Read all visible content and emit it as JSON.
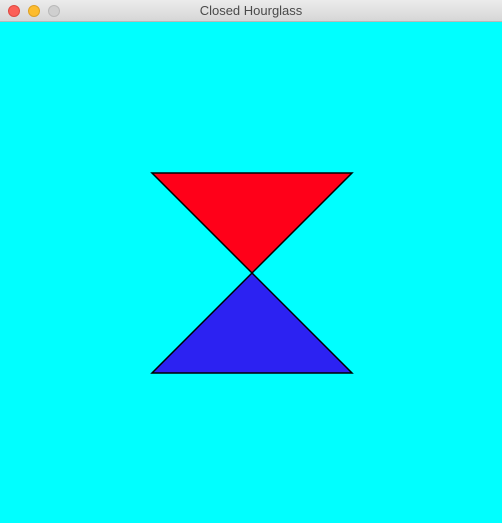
{
  "window": {
    "title": "Closed Hourglass"
  },
  "colors": {
    "canvas_background": "#00ffff",
    "top_triangle_fill": "#ff0019",
    "bottom_triangle_fill": "#2c22f2",
    "outline": "#000000"
  },
  "icons": {
    "close": "close-icon",
    "minimize": "minimize-icon",
    "zoom": "zoom-icon"
  }
}
